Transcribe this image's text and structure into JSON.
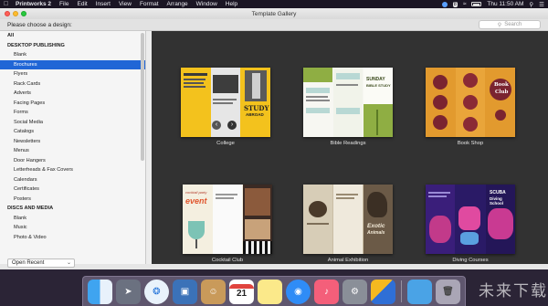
{
  "menubar": {
    "items": [
      "Printworks 2",
      "File",
      "Edit",
      "Insert",
      "View",
      "Format",
      "Arrange",
      "Window",
      "Help"
    ],
    "status_badge": "8",
    "clock": "Thu 11:50 AM"
  },
  "window": {
    "title": "Template Gallery",
    "prompt": "Please choose a design:",
    "search_placeholder": "Search"
  },
  "sidebar": {
    "items": [
      {
        "label": "All",
        "header": true
      },
      {
        "label": "DESKTOP PUBLISHING",
        "header": true
      },
      {
        "label": "Blank"
      },
      {
        "label": "Brochures",
        "selected": true
      },
      {
        "label": "Flyers"
      },
      {
        "label": "Rack Cards"
      },
      {
        "label": "Adverts"
      },
      {
        "label": "Facing Pages"
      },
      {
        "label": "Forms"
      },
      {
        "label": "Social Media"
      },
      {
        "label": "Catalogs"
      },
      {
        "label": "Newsletters"
      },
      {
        "label": "Menus"
      },
      {
        "label": "Door Hangers"
      },
      {
        "label": "Letterheads & Fax Covers"
      },
      {
        "label": "Calendars"
      },
      {
        "label": "Certificates"
      },
      {
        "label": "Posters"
      },
      {
        "label": "DISCS AND MEDIA",
        "header": true
      },
      {
        "label": "Blank"
      },
      {
        "label": "Music"
      },
      {
        "label": "Photo & Video"
      }
    ]
  },
  "gallery": {
    "templates": [
      {
        "caption": "College",
        "thumb": {
          "tag": "STUDY",
          "sub": "ABROAD",
          "bg": "#f3c21d"
        }
      },
      {
        "caption": "Bible Readings",
        "thumb": {
          "tag": "SUNDAY",
          "sub": "BIBLE STUDY",
          "bg": "#8fae43"
        }
      },
      {
        "caption": "Book Shop",
        "thumb": {
          "tag": "Book",
          "sub": "Club",
          "bg": "#e29a2e"
        }
      },
      {
        "caption": "Cocktail Club",
        "thumb": {
          "tag": "event",
          "sub": "cocktail party",
          "bg": "#f4efe0"
        }
      },
      {
        "caption": "Animal Exhibition",
        "thumb": {
          "tag": "Exotic",
          "sub": "Animals",
          "bg": "#c9bda4"
        }
      },
      {
        "caption": "Diving Courses",
        "thumb": {
          "tag": "SCUBA",
          "sub": "Diving School",
          "bg": "#2a1a66"
        }
      }
    ]
  },
  "footer": {
    "open_recent": "Open Recent"
  },
  "dock": {
    "icons": [
      "finder-icon",
      "launchpad-icon",
      "safari-icon",
      "preview-icon",
      "contacts-icon",
      "calendar-icon",
      "notes-icon",
      "messages-icon",
      "music-icon",
      "system-preferences-icon",
      "printworks-icon",
      "folder-icon",
      "trash-icon"
    ],
    "calendar_day": "21",
    "watermark": "未来下载"
  },
  "colors": {
    "selection": "#2066d6",
    "gallery_bg": "#323232",
    "sidebar_bg": "#f5f5f5"
  }
}
